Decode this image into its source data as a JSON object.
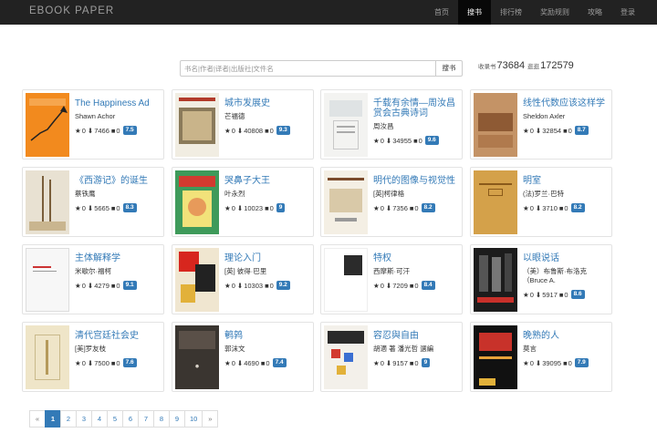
{
  "nav": {
    "brand": "EBOOK    PAPER",
    "items": [
      "首页",
      "搜书",
      "排行榜",
      "奖励规则",
      "攻略",
      "登录"
    ],
    "active_index": 1
  },
  "search": {
    "placeholder": "书名|作者|译者|出版社|文件名",
    "button": "搜书"
  },
  "stats": {
    "books_label": "收录书",
    "books_value": "73684",
    "reads_label": "逛逛",
    "reads_value": "172579"
  },
  "books": [
    {
      "title": "The Happiness Ad",
      "author": "Shawn Achor",
      "stars": "0",
      "downloads": "7466",
      "comments": "0",
      "rating": "7.5"
    },
    {
      "title": "城市发展史",
      "author": "芒福德",
      "stars": "0",
      "downloads": "40808",
      "comments": "0",
      "rating": "9.3"
    },
    {
      "title": "千载有余情—周汝昌赏会古典诗词",
      "author": "周汝昌",
      "stars": "0",
      "downloads": "34955",
      "comments": "0",
      "rating": "9.6"
    },
    {
      "title": "线性代数应该这样学",
      "author": "Sheldon Axler",
      "stars": "0",
      "downloads": "32854",
      "comments": "0",
      "rating": "8.7"
    },
    {
      "title": "《西游记》的诞生",
      "author": "蔡铁鹰",
      "stars": "0",
      "downloads": "5665",
      "comments": "0",
      "rating": "8.3"
    },
    {
      "title": "哭鼻子大王",
      "author": "叶永烈",
      "stars": "0",
      "downloads": "10023",
      "comments": "0",
      "rating": "9"
    },
    {
      "title": "明代的图像与视觉性",
      "author": "[英]柯律格",
      "stars": "0",
      "downloads": "7356",
      "comments": "0",
      "rating": "8.2"
    },
    {
      "title": "明室",
      "author": "(法)罗兰·巴特",
      "stars": "0",
      "downloads": "3710",
      "comments": "0",
      "rating": "8.2"
    },
    {
      "title": "主体解释学",
      "author": "米歇尔·福柯",
      "stars": "0",
      "downloads": "4279",
      "comments": "0",
      "rating": "9.1"
    },
    {
      "title": "理论入门",
      "author": "[英] 彼得·巴里",
      "stars": "0",
      "downloads": "10303",
      "comments": "0",
      "rating": "9.2"
    },
    {
      "title": "特权",
      "author": "西摩斯·可汗",
      "stars": "0",
      "downloads": "7209",
      "comments": "0",
      "rating": "8.4"
    },
    {
      "title": "以眼说话",
      "author": "（美）布鲁斯·布洛克（Bruce A.",
      "stars": "0",
      "downloads": "5917",
      "comments": "0",
      "rating": "8.6"
    },
    {
      "title": "清代宫廷社会史",
      "author": "[美]罗友枝",
      "stars": "0",
      "downloads": "7500",
      "comments": "0",
      "rating": "7.6"
    },
    {
      "title": "鹌鹑",
      "author": "郭沫文",
      "stars": "0",
      "downloads": "4690",
      "comments": "0",
      "rating": "7.4"
    },
    {
      "title": "容忍與自由",
      "author": "胡適 著 潘光哲 選編",
      "stars": "0",
      "downloads": "9157",
      "comments": "0",
      "rating": "9"
    },
    {
      "title": "晚熟的人",
      "author": "莫言",
      "stars": "0",
      "downloads": "39095",
      "comments": "0",
      "rating": "7.9"
    }
  ],
  "pagination": {
    "prev": "«",
    "pages": [
      "1",
      "2",
      "3",
      "4",
      "5",
      "6",
      "7",
      "8",
      "9",
      "10"
    ],
    "next": "»",
    "active": "1"
  },
  "icons": {
    "star": "star-icon",
    "download": "download-icon",
    "comment": "comment-icon"
  },
  "colors": {
    "navbar": "#222222",
    "link": "#337ab7",
    "badge": "#337ab7"
  }
}
